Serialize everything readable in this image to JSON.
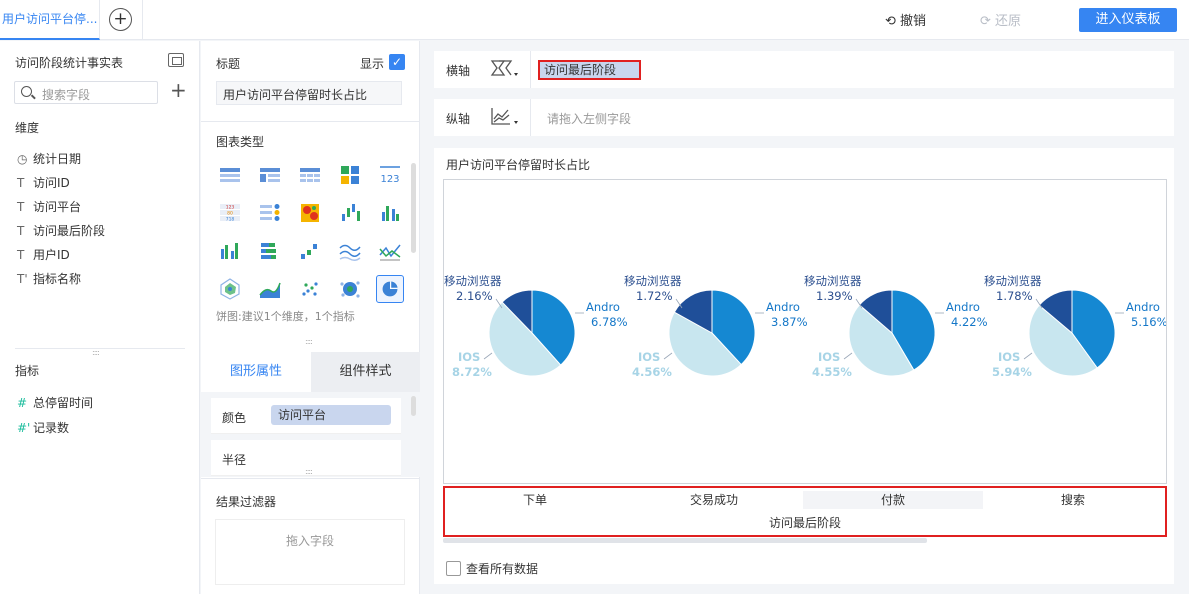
{
  "topbar": {
    "tab_label": "用户访问平台停...",
    "undo_label": "撤销",
    "redo_label": "还原",
    "enter_label": "进入仪表板"
  },
  "left": {
    "table_name": "访问阶段统计事实表",
    "search_placeholder": "搜索字段",
    "dimension_label": "维度",
    "dimensions": [
      {
        "icon": "clock-icon",
        "label": "统计日期"
      },
      {
        "icon": "text-icon",
        "label": "访问ID"
      },
      {
        "icon": "text-icon",
        "label": "访问平台"
      },
      {
        "icon": "text-icon",
        "label": "访问最后阶段"
      },
      {
        "icon": "text-icon",
        "label": "用户ID"
      },
      {
        "icon": "text-icon",
        "label": "指标名称"
      }
    ],
    "measure_label": "指标",
    "measures": [
      {
        "icon": "hash-icon",
        "label": "总停留时间"
      },
      {
        "icon": "hash-icon",
        "label": "记录数"
      }
    ]
  },
  "middle": {
    "title_label": "标题",
    "show_label": "显示",
    "title_value": "用户访问平台停留时长占比",
    "chart_type_label": "图表类型",
    "chart_hint": "饼图:建议1个维度，1个指标",
    "tab_graphic": "图形属性",
    "tab_component": "组件样式",
    "color_label": "颜色",
    "color_field": "访问平台",
    "radius_label": "半径",
    "filter_label": "结果过滤器",
    "filter_placeholder": "拖入字段"
  },
  "right": {
    "x_axis_label": "横轴",
    "x_field": "访问最后阶段",
    "y_axis_label": "纵轴",
    "y_placeholder": "请拖入左侧字段",
    "view_all_label": "查看所有数据"
  },
  "colors": {
    "accent": "#3685f2",
    "mobile": "#1f4f99",
    "android": "#1588d2",
    "ios": "#c8e6ef",
    "highlight_border": "#e02020"
  },
  "chart_data": {
    "type": "pie",
    "title": "用户访问平台停留时长占比",
    "xlabel": "访问最后阶段",
    "categories": [
      "下单",
      "交易成功",
      "付款",
      "搜索"
    ],
    "series_labels": [
      "移动浏览器",
      "Android",
      "IOS"
    ],
    "label_texts": [
      "移动浏览器",
      "Andro",
      "IOS"
    ],
    "pies": [
      {
        "category": "下单",
        "values": [
          2.16,
          6.78,
          8.72
        ],
        "pct": [
          "2.16%",
          "6.78%",
          "8.72%"
        ]
      },
      {
        "category": "交易成功",
        "values": [
          1.72,
          3.87,
          4.56
        ],
        "pct": [
          "1.72%",
          "3.87%",
          "4.56%"
        ]
      },
      {
        "category": "付款",
        "values": [
          1.39,
          4.22,
          4.55
        ],
        "pct": [
          "1.39%",
          "4.22%",
          "4.55%"
        ]
      },
      {
        "category": "搜索",
        "values": [
          1.78,
          5.16,
          5.94
        ],
        "pct": [
          "1.78%",
          "5.16%",
          "5.94%"
        ]
      }
    ]
  }
}
